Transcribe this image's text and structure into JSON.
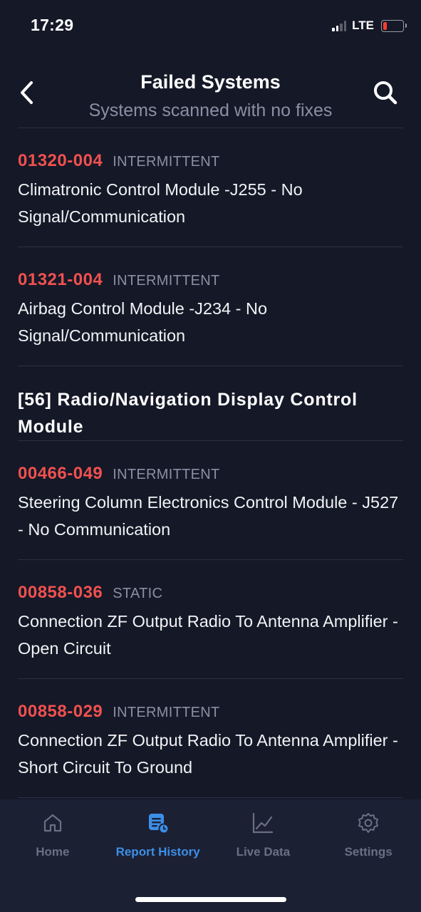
{
  "status": {
    "time": "17:29",
    "network": "LTE"
  },
  "header": {
    "title": "Failed Systems",
    "subtitle": "Systems scanned with no fixes"
  },
  "faults_top": [
    {
      "code": "01320-004",
      "type": "INTERMITTENT",
      "description": "Climatronic Control Module -J255 - No Signal/Communication"
    },
    {
      "code": "01321-004",
      "type": "INTERMITTENT",
      "description": "Airbag Control Module -J234 - No Signal/Communication"
    }
  ],
  "section": {
    "title": "[56] Radio/Navigation Display Control Module"
  },
  "faults_section": [
    {
      "code": "00466-049",
      "type": "INTERMITTENT",
      "description": "Steering Column Electronics Control Module - J527 - No Communication"
    },
    {
      "code": "00858-036",
      "type": "STATIC",
      "description": "Connection ZF Output Radio To Antenna Amplifier - Open Circuit"
    },
    {
      "code": "00858-029",
      "type": "INTERMITTENT",
      "description": "Connection ZF Output Radio To Antenna Amplifier - Short Circuit To Ground"
    }
  ],
  "tabs": [
    {
      "label": "Home",
      "icon": "home-icon"
    },
    {
      "label": "Report History",
      "icon": "report-history-icon"
    },
    {
      "label": "Live Data",
      "icon": "live-data-icon"
    },
    {
      "label": "Settings",
      "icon": "settings-icon"
    }
  ],
  "colors": {
    "background": "#151827",
    "fault_code": "#f0514f",
    "active_tab": "#3b8fe8",
    "inactive_tab": "#6b6f83"
  }
}
